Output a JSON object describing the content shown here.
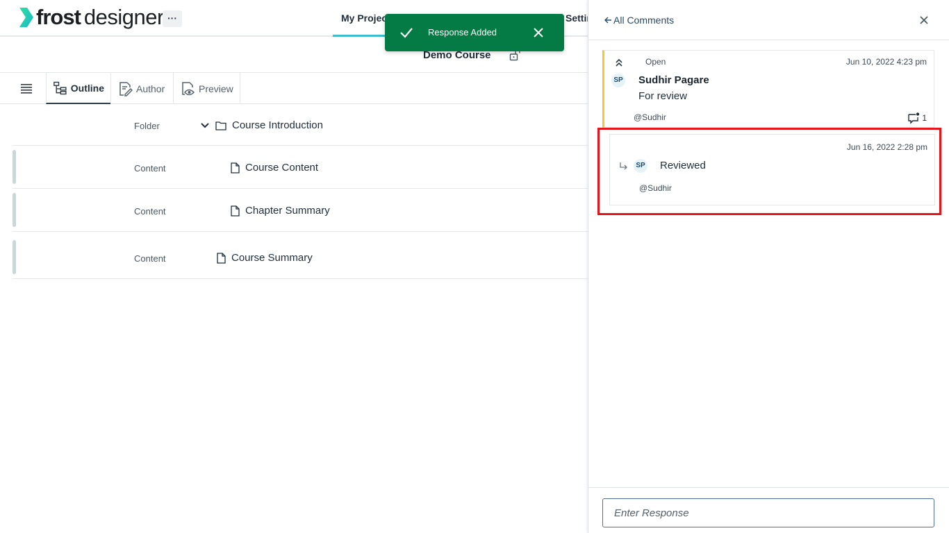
{
  "header": {
    "logo_bold": "frost",
    "logo_regular": "designer",
    "more_label": "···",
    "nav": [
      {
        "label": "My Projec"
      },
      {
        "label": "Settin"
      }
    ]
  },
  "course": {
    "title": "Demo Course"
  },
  "tabs": [
    {
      "label": "Outline"
    },
    {
      "label": "Author"
    },
    {
      "label": "Preview"
    }
  ],
  "outline": [
    {
      "type": "Folder",
      "title": "Course Introduction"
    },
    {
      "type": "Content",
      "title": "Course Content"
    },
    {
      "type": "Content",
      "title": "Chapter Summary"
    },
    {
      "type": "Content",
      "title": "Course Summary"
    }
  ],
  "toast": {
    "message": "Response Added"
  },
  "panel": {
    "back_label": "All Comments",
    "comment": {
      "status": "Open",
      "date": "Jun 10, 2022 4:23 pm",
      "avatar": "SP",
      "author": "Sudhir Pagare",
      "body": "For review",
      "mention": "@Sudhir",
      "reply_count": "1"
    },
    "reply": {
      "date": "Jun 16, 2022 2:28 pm",
      "avatar": "SP",
      "body": "Reviewed",
      "mention": "@Sudhir"
    },
    "input_placeholder": "Enter Response"
  },
  "colors": {
    "accent": "#3bbcd0",
    "toast_bg": "#047a44",
    "open_status": "#f3c53a",
    "highlight": "#e3151b",
    "logo_green": "#1fd38a"
  }
}
